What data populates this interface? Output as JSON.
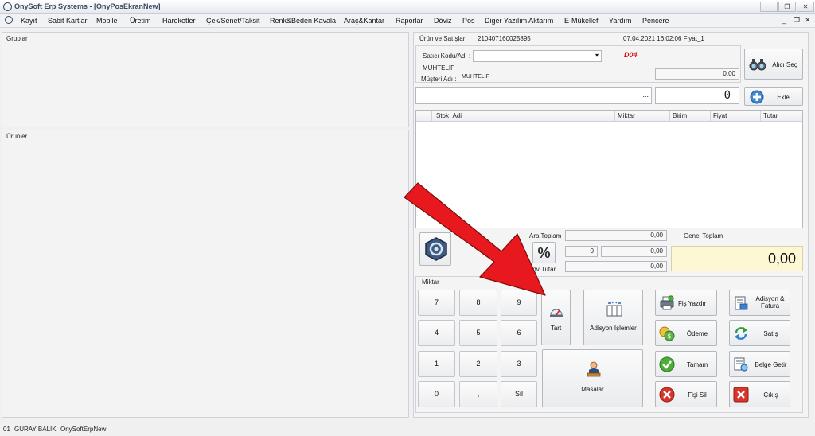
{
  "window": {
    "title": "OnySoft Erp Systems - [OnyPosEkranNew]",
    "controls": [
      "_",
      "❐",
      "✕"
    ]
  },
  "menu": {
    "items": [
      "Kayıt",
      "Sabit Kartlar",
      "Mobile",
      "Üretim",
      "Hareketler",
      "Çek/Senet/Taksit",
      "Renk&Beden Kavala",
      "Araç&Kantar",
      "Raporlar",
      "Döviz",
      "Pos",
      "Diger Yazılım Aktarım",
      "E-Mükellef",
      "Yardım",
      "Pencere"
    ],
    "mdi_controls": [
      "_",
      "❐",
      "✕"
    ]
  },
  "left": {
    "groups_title": "Gruplar",
    "products_title": "Ürünler"
  },
  "sale": {
    "header_title": "Ürün ve Satışlar",
    "doc_no": "210407160025895",
    "datetime": "07.04.2021 16:02:06 Fiyat_1",
    "seller_label": "Satıcı Kodu/Adı :",
    "seller_value": "",
    "code_badge": "D04",
    "customer_name": "MUHTELIF",
    "customer_label": "Müşteri Adı :",
    "customer_value": "MUHTELIF",
    "buyer_amount": "0,00",
    "buyer_button": "Alıcı Seç",
    "product_search_value": "",
    "search_dots": "...",
    "quantity_value": "0",
    "add_button": "Ekle"
  },
  "grid": {
    "columns": [
      "Stok_Adi",
      "Miktar",
      "Birim",
      "Fiyat",
      "Tutar"
    ]
  },
  "totals": {
    "subtotal_label": "Ara Toplam",
    "subtotal_value": "0,00",
    "discount_percent": "0",
    "discount_amount": "0,00",
    "vat_label": "Kdv Tutar",
    "vat_value": "0,00",
    "grand_total_label": "Genel Toplam",
    "grand_total_value": "0,00",
    "percent_symbol": "%"
  },
  "keypad": {
    "title": "Miktar",
    "keys": [
      "7",
      "8",
      "9",
      "4",
      "5",
      "6",
      "1",
      "2",
      "3",
      "0",
      ",",
      "Sil"
    ]
  },
  "actions": {
    "tare": "Tart",
    "ticket_ops": "Adisyon İşlemler",
    "tables": "Masalar",
    "print_receipt": "Fiş Yazdır",
    "payment": "Ödeme",
    "done": "Tamam",
    "delete_receipt": "Fişi Sil",
    "ticket_invoice": "Adisyon & Fatura",
    "sale": "Satış",
    "get_document": "Belge Getir",
    "exit": "Çıkış"
  },
  "status": {
    "user_code": "01",
    "user_name": "GURAY BALIK",
    "database": "OnySoftErpNew"
  },
  "colors": {
    "arrow": "#e8191e",
    "grand_total_bg": "#fdf7d4",
    "badge": "#d01818"
  }
}
